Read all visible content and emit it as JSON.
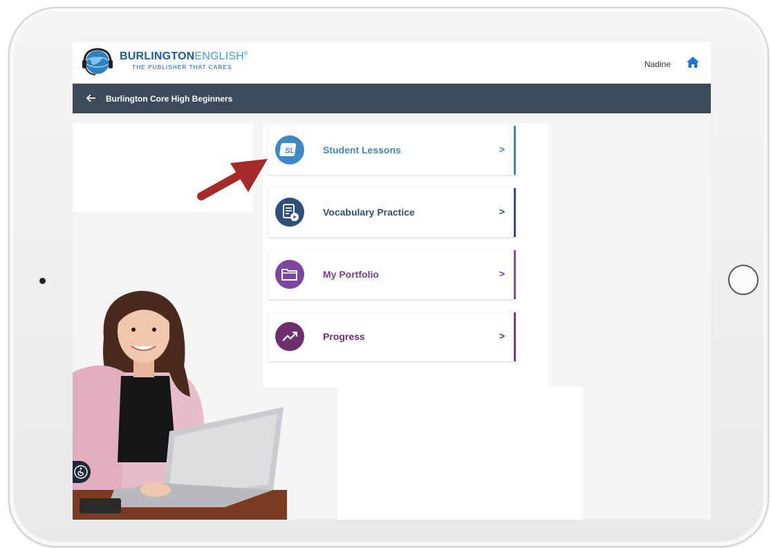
{
  "header": {
    "brand_bold": "BURLINGTON",
    "brand_light": "ENGLISH",
    "brand_mark": "®",
    "tagline": "THE PUBLISHER THAT CARES",
    "user_name": "Nadine",
    "home_icon": "home-icon"
  },
  "navbar": {
    "back_icon": "arrow-left-icon",
    "course_title": "Burlington Core High Beginners"
  },
  "menu": [
    {
      "label": "Student Lessons",
      "icon": "sl-icon",
      "icon_text": "SL",
      "chevron": ">",
      "color": "#3f88c5",
      "dark": "#3f88c5"
    },
    {
      "label": "Vocabulary Practice",
      "icon": "vocabulary-icon",
      "chevron": ">",
      "color": "#2e5d8e",
      "dark": "#2e4f7a"
    },
    {
      "label": "My Portfolio",
      "icon": "folder-icon",
      "chevron": ">",
      "color": "#8a4a9c",
      "dark": "#6f3f8c"
    },
    {
      "label": "Progress",
      "icon": "trend-icon",
      "chevron": ">",
      "color": "#7a3a7c",
      "dark": "#6a2f70"
    }
  ],
  "accessibility_icon": "accessibility-icon",
  "annotation": "red-arrow-pointer"
}
